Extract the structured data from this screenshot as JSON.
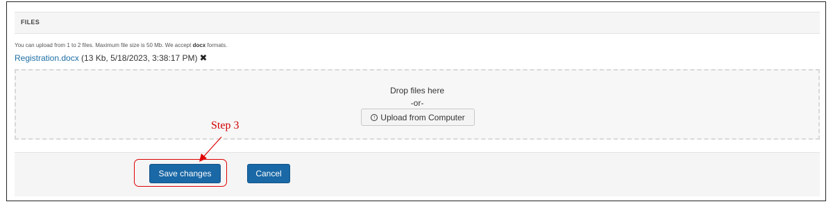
{
  "files": {
    "title": "FILES",
    "info_prefix": "You can upload from 1 to 2 files. Maximum file size is 50 Mb. We accept ",
    "info_formats": "docx",
    "info_suffix": " formats.",
    "file": {
      "name": "Registration.docx",
      "details": " (13 Kb, 5/18/2023, 3:38:17 PM)",
      "remove_icon": "✖"
    }
  },
  "dropzone": {
    "drop_text": "Drop files here",
    "or_text": "-or-",
    "upload_icon": "↑",
    "upload_label": "Upload from Computer"
  },
  "actions": {
    "save_label": "Save changes",
    "cancel_label": "Cancel"
  },
  "annotation": {
    "step_label": "Step 3",
    "color": "#e00000"
  }
}
